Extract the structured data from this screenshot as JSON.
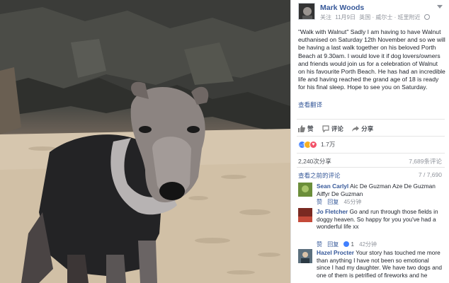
{
  "post": {
    "author": "Mark Woods",
    "follow": "关注",
    "date": "11月9日",
    "location": "英国 · 威尔士 · 班里附近",
    "text": "\"Walk with Walnut\" Sadly I am having to have Walnut euthanised on Saturday 12th November and so we will be having a last walk together on his beloved Porth Beach at 9.30am. I would love it if dog lovers/owners and friends would join us for a celebration of Walnut on his favourite Porth Beach. He has had an incredible life and having reached the grand age of 18 is ready for his final sleep. Hope to see you on Saturday.",
    "see_translation": "查看翻译"
  },
  "actions": {
    "like": "赞",
    "comment": "评论",
    "share": "分享"
  },
  "stats": {
    "reaction_count": "1.7万",
    "shares": "2,240次分享",
    "views": "7,689条评论",
    "view_previous": "查看之前的评论",
    "comment_progress": "7 / 7,690"
  },
  "comments": [
    {
      "name": "Sean Carlyl",
      "text": "Aic De Guzman Aze De Guzman Aiffyr De Guzman",
      "like": "赞",
      "reply": "回复",
      "time": "45分钟",
      "likes": ""
    },
    {
      "name": "Jo Fletcher",
      "text": "Go and run through those fields in doggy heaven. So happy for you you've had a wonderful life xx",
      "like": "赞",
      "reply": "回复",
      "time": "42分钟",
      "likes": "1"
    },
    {
      "name": "Hazel Procter",
      "text": "Your story has touched me more than anything I have not been so emotional since I had my daughter. We have two dogs and one of them is petrified of fireworks and he",
      "like": "",
      "reply": "",
      "time": "",
      "likes": ""
    }
  ],
  "colors": {
    "link": "#365899",
    "text": "#1d2129",
    "muted": "#90949c",
    "like_blue": "#4080ff"
  },
  "icons": [
    "like-thumb-icon",
    "comment-icon",
    "share-icon",
    "globe-icon",
    "dropdown-caret-icon",
    "like-reaction-icon",
    "sad-reaction-icon",
    "love-reaction-icon"
  ]
}
